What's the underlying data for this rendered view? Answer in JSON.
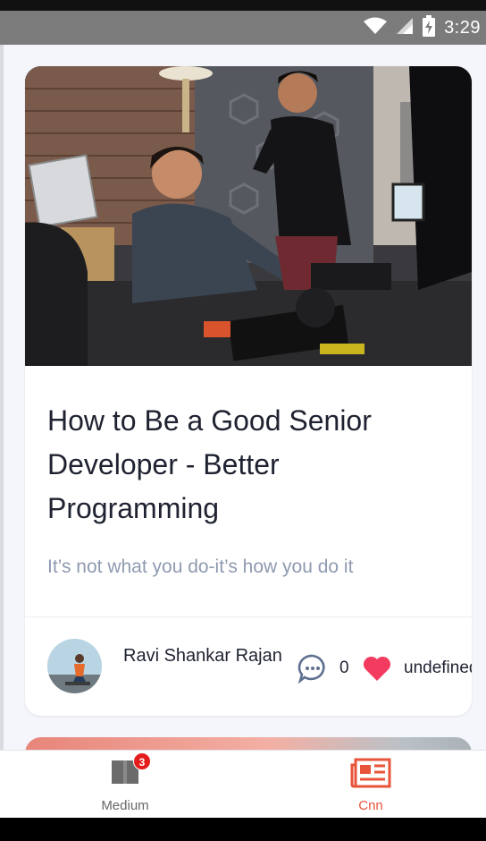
{
  "status_bar": {
    "time": "3:29",
    "icons": [
      "wifi-icon",
      "signal-icon",
      "battery-charging-icon"
    ]
  },
  "article": {
    "title": "How to Be a Good Senior Developer - Better Programming",
    "subtitle": "It’s not what you do-it’s how you do it",
    "author": "Ravi Shankar Rajan",
    "comments": "0",
    "likes": "undefined"
  },
  "tabs": [
    {
      "label": "Medium",
      "icon": "book-icon",
      "badge": "3",
      "active": false
    },
    {
      "label": "Cnn",
      "icon": "newspaper-icon",
      "active": true
    }
  ],
  "colors": {
    "accent": "#e8543a",
    "heart": "#f23b5f",
    "badge": "#e41c1c",
    "subtitle": "#8f9ab0",
    "status_bar": "#7b7b7b"
  }
}
